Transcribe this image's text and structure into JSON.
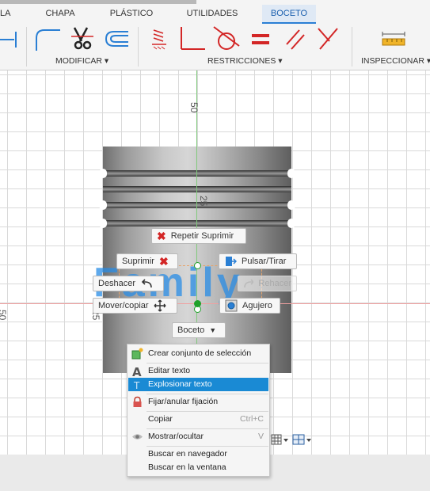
{
  "ribbon": {
    "tabs": [
      {
        "id": "la",
        "label": "LA"
      },
      {
        "id": "chapa",
        "label": "CHAPA"
      },
      {
        "id": "plastico",
        "label": "PLÁSTICO"
      },
      {
        "id": "utilidades",
        "label": "UTILIDADES"
      },
      {
        "id": "boceto",
        "label": "BOCETO"
      }
    ],
    "groups": {
      "modificar": "MODIFICAR ▾",
      "restricciones": "RESTRICCIONES ▾",
      "inspeccionar": "INSPECCIONAR ▾"
    }
  },
  "canvas": {
    "ruler_top": "50",
    "ruler_mid": "25",
    "ruler_left_25": "25",
    "ruler_left_50": "50",
    "sketch_text": "Family"
  },
  "marking_menu": {
    "repeat": "Repetir Suprimir",
    "delete": "Suprimir",
    "press_pull": "Pulsar/Tirar",
    "undo": "Deshacer",
    "redo": "Rehacer",
    "move_copy": "Mover/copiar",
    "hole": "Agujero",
    "sketch": "Boceto"
  },
  "context_menu": {
    "create_selection_set": "Crear conjunto de selección",
    "edit_text": "Editar texto",
    "explode_text": "Explosionar texto",
    "fix_unfix": "Fijar/anular fijación",
    "copy": "Copiar",
    "copy_shortcut": "Ctrl+C",
    "show_hide": "Mostrar/ocultar",
    "show_hide_shortcut": "V",
    "find_in_browser": "Buscar en navegador",
    "find_in_window": "Buscar en la ventana"
  },
  "colors": {
    "accent": "#1a8ad4",
    "active_tab": "#1a5fae",
    "axis_green": "#7fc97a",
    "axis_red": "#f0a0a0",
    "delete_red": "#d32626"
  }
}
